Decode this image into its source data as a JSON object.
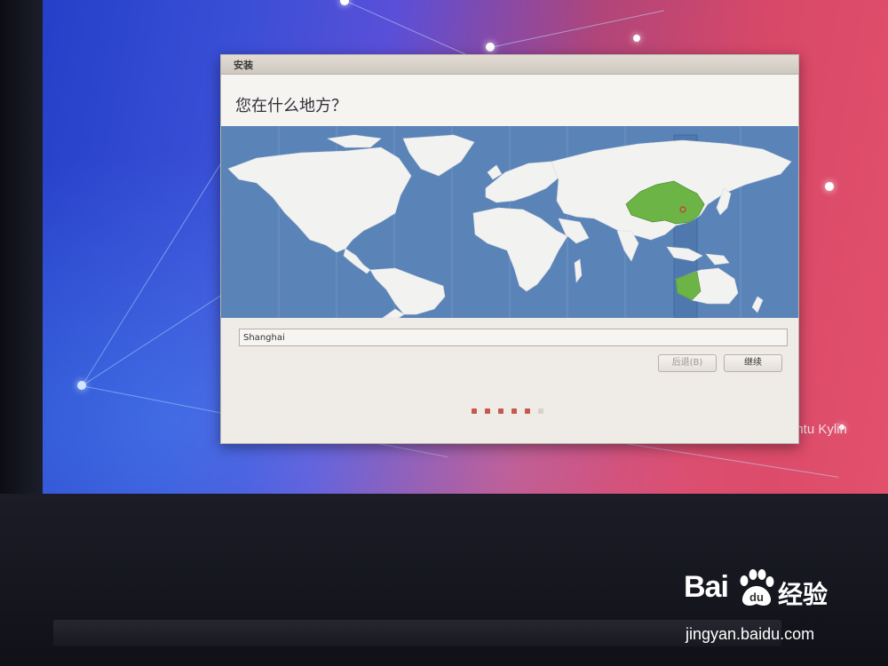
{
  "wallpaper": {
    "brand_text": "untu Kylin",
    "accent": "#e2506c"
  },
  "installer": {
    "window_title": "安装",
    "heading": "您在什么地方？",
    "map": {
      "selected_region": "China",
      "ocean_color": "#5a84b8",
      "land_color": "#f2f2f0",
      "highlight_color": "#6db447",
      "pin_icon": "location-dot-icon"
    },
    "timezone_input": {
      "value": "Shanghai",
      "placeholder": ""
    },
    "buttons": {
      "back_label": "后退(B)",
      "continue_label": "继续"
    },
    "progress": {
      "total_steps": 6,
      "completed_steps": 5
    }
  },
  "watermark": {
    "logo_text": "Bai",
    "logo_suffix": "经验",
    "url": "jingyan.baidu.com",
    "paw_icon": "baidu-paw-icon"
  }
}
